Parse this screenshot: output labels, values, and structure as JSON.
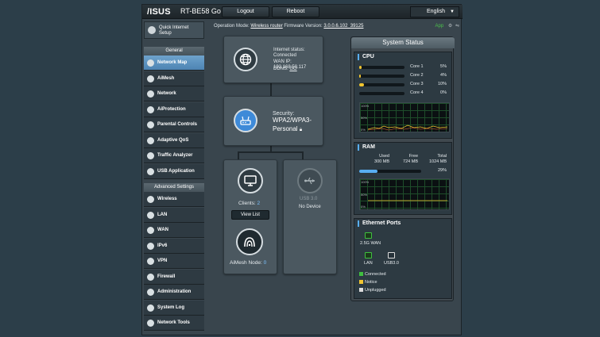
{
  "header": {
    "brand": "/ISUS",
    "model": "RT-BE58 Go",
    "logout_label": "Logout",
    "reboot_label": "Reboot",
    "language": "English"
  },
  "opbar": {
    "prefix": "Operation Mode: ",
    "mode": "Wireless router",
    "fw_prefix": " Firmware Version: ",
    "firmware": "3.0.0.6.102_39125",
    "app_label": "App"
  },
  "sidebar": {
    "quick_setup": [
      "Quick Internet",
      "Setup"
    ],
    "general_label": "General",
    "general_items": [
      "Network Map",
      "AiMesh",
      "Network",
      "AiProtection",
      "Parental Controls",
      "Adaptive QoS",
      "Traffic Analyzer",
      "USB Application"
    ],
    "advanced_label": "Advanced Settings",
    "advanced_items": [
      "Wireless",
      "LAN",
      "WAN",
      "IPv6",
      "VPN",
      "Firewall",
      "Administration",
      "System Log",
      "Network Tools"
    ]
  },
  "map": {
    "internet_status_label": "Internet status:",
    "internet_status": "Connected",
    "wan_ip_label": "WAN IP:",
    "wan_ip": "192.168.50.117",
    "ddns_label": "DDNS:",
    "ddns_value": "GO",
    "security_label": "Security:",
    "security_value_1": "WPA2/WPA3-",
    "security_value_2": "Personal",
    "clients_label": "Clients:",
    "clients_count": "2",
    "view_list": "View List",
    "usb_label": "USB 3.0",
    "usb_status": "No Device",
    "aimesh_label": "AiMesh Node:",
    "aimesh_count": "0"
  },
  "status": {
    "title": "System Status",
    "cpu_label": "CPU",
    "cores": [
      {
        "name": "Core 1",
        "pct": "5%",
        "value": 5
      },
      {
        "name": "Core 2",
        "pct": "4%",
        "value": 4
      },
      {
        "name": "Core 3",
        "pct": "10%",
        "value": 10
      },
      {
        "name": "Core 4",
        "pct": "0%",
        "value": 0
      }
    ],
    "graph_ticks": [
      "100%",
      "50%",
      "0%"
    ],
    "ram_label": "RAM",
    "ram_used_label": "Used",
    "ram_used": "300 MB",
    "ram_free_label": "Free",
    "ram_free": "724 MB",
    "ram_total_label": "Total",
    "ram_total": "1024 MB",
    "ram_pct": "29%",
    "ram_value": 29,
    "eth_label": "Ethernet Ports",
    "port_wan": "2.5G WAN",
    "port_lan": "LAN",
    "port_usb": "USB3.0",
    "legend_connected": "Connected",
    "legend_notice": "Notice",
    "legend_unplugged": "Unplugged",
    "colors": {
      "connected": "#3fbf3f",
      "notice": "#f1c530",
      "unplugged": "#dddddd",
      "accent": "#4d84b3"
    }
  }
}
